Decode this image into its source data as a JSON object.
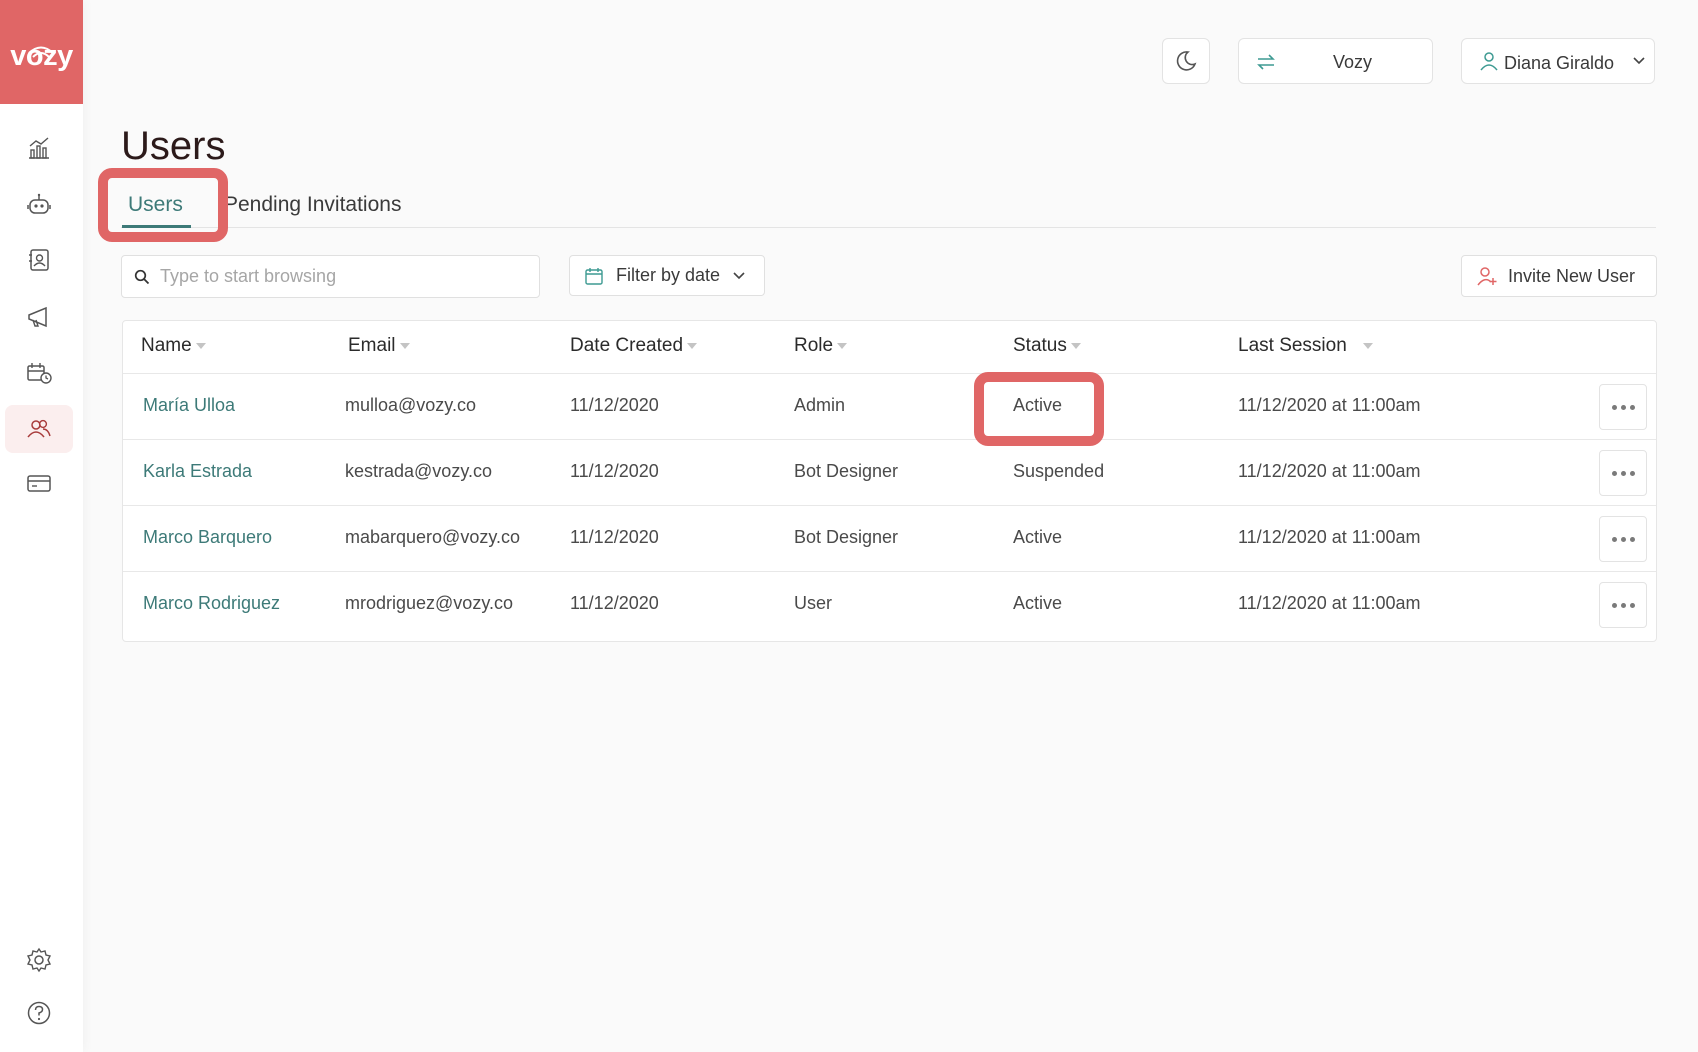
{
  "brand": {
    "logo_text": "vozy",
    "accent": "#e06666",
    "teal": "#3d7a78"
  },
  "sidebar": {
    "items": [
      {
        "icon": "analytics-icon",
        "active": false
      },
      {
        "icon": "bot-icon",
        "active": false
      },
      {
        "icon": "contacts-icon",
        "active": false
      },
      {
        "icon": "campaign-icon",
        "active": false
      },
      {
        "icon": "schedule-icon",
        "active": false
      },
      {
        "icon": "users-icon",
        "active": true
      },
      {
        "icon": "billing-icon",
        "active": false
      }
    ],
    "bottom": [
      {
        "icon": "gear-icon"
      },
      {
        "icon": "help-icon"
      }
    ]
  },
  "header": {
    "org_label": "Vozy",
    "user_label": "Diana Giraldo"
  },
  "page": {
    "title": "Users"
  },
  "tabs": [
    {
      "label": "Users",
      "active": true
    },
    {
      "label": "Pending Invitations",
      "active": false
    }
  ],
  "toolbar": {
    "search_placeholder": "Type to start browsing",
    "filter_label": "Filter by date",
    "invite_label": "Invite New User"
  },
  "table": {
    "columns": [
      "Name",
      "Email",
      "Date Created",
      "Role",
      "Status",
      "Last Session"
    ],
    "rows": [
      {
        "name": "María Ulloa",
        "email": "mulloa@vozy.co",
        "date": "11/12/2020",
        "role": "Admin",
        "status": "Active",
        "last": "11/12/2020 at 11:00am"
      },
      {
        "name": "Karla Estrada",
        "email": "kestrada@vozy.co",
        "date": "11/12/2020",
        "role": "Bot Designer",
        "status": "Suspended",
        "last": "11/12/2020 at 11:00am"
      },
      {
        "name": "Marco Barquero",
        "email": "mabarquero@vozy.co",
        "date": "11/12/2020",
        "role": "Bot Designer",
        "status": "Active",
        "last": "11/12/2020 at 11:00am"
      },
      {
        "name": "Marco Rodriguez",
        "email": "mrodriguez@vozy.co",
        "date": "11/12/2020",
        "role": "User",
        "status": "Active",
        "last": "11/12/2020 at 11:00am"
      }
    ]
  }
}
